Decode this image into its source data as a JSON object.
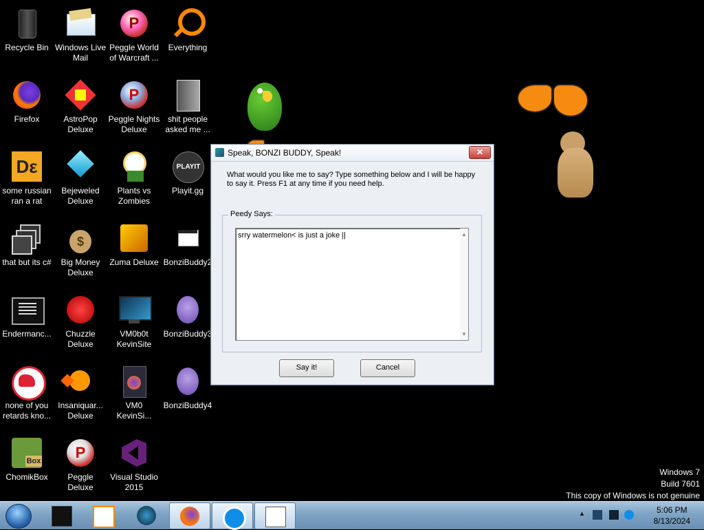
{
  "desktop": {
    "icons": [
      {
        "label": "Recycle Bin",
        "icon": "recycle-bin-icon"
      },
      {
        "label": "Windows Live Mail",
        "icon": "mail-icon"
      },
      {
        "label": "Peggle World of Warcraft ...",
        "icon": "peggle-icon"
      },
      {
        "label": "Everything",
        "icon": "search-icon"
      },
      {
        "label": "Firefox",
        "icon": "firefox-icon"
      },
      {
        "label": "AstroPop Deluxe",
        "icon": "astropop-icon"
      },
      {
        "label": "Peggle Nights Deluxe",
        "icon": "peggle-icon"
      },
      {
        "label": "shit people asked me ...",
        "icon": "folder-icon"
      },
      {
        "label": "some russian ran a rat",
        "icon": "de-icon"
      },
      {
        "label": "Bejeweled Deluxe",
        "icon": "gem-icon"
      },
      {
        "label": "Plants vs Zombies",
        "icon": "plant-icon"
      },
      {
        "label": "Playit.gg",
        "icon": "playit-icon"
      },
      {
        "label": "that but its c#",
        "icon": "windows-stack-icon"
      },
      {
        "label": "Big Money Deluxe",
        "icon": "money-bag-icon"
      },
      {
        "label": "Zuma Deluxe",
        "icon": "zuma-icon"
      },
      {
        "label": "BonziBuddy2",
        "icon": "shortcut-icon"
      },
      {
        "label": "Endermanc...",
        "icon": "console-icon"
      },
      {
        "label": "Chuzzle Deluxe",
        "icon": "chuzzle-icon"
      },
      {
        "label": "VM0b0t KevinSite",
        "icon": "monitor-icon"
      },
      {
        "label": "BonziBuddy3",
        "icon": "bonzi-icon"
      },
      {
        "label": "none of you retards kno...",
        "icon": "dino-icon"
      },
      {
        "label": "Insaniquar... Deluxe",
        "icon": "fish-icon"
      },
      {
        "label": "VM0 KevinSi...",
        "icon": "firefox-doc-icon"
      },
      {
        "label": "BonziBuddy4",
        "icon": "bonzi-icon"
      },
      {
        "label": "ChomikBox",
        "icon": "chomikbox-icon"
      },
      {
        "label": "Peggle Deluxe",
        "icon": "peggle-icon"
      },
      {
        "label": "Visual Studio 2015",
        "icon": "visual-studio-icon"
      }
    ]
  },
  "dialog": {
    "title": "Speak, BONZI BUDDY, Speak!",
    "prompt": "What would you like me to say? Type something below and I will be happy to say it. Press F1 at any time if you need help.",
    "group_label": "Peedy Says:",
    "text_value": "srry watermelon< is just a joke ||",
    "say_button": "Say it!",
    "cancel_button": "Cancel",
    "close_glyph": "✕"
  },
  "watermark": {
    "line1": "Windows 7",
    "line2": "Build 7601",
    "line3": "This copy of Windows is not genuine"
  },
  "taskbar": {
    "items": [
      "black-box-icon",
      "media-player-icon",
      "globe-icon",
      "firefox-icon",
      "teamviewer-icon",
      "window-icon"
    ],
    "time": "5:06 PM",
    "date": "8/13/2024"
  }
}
